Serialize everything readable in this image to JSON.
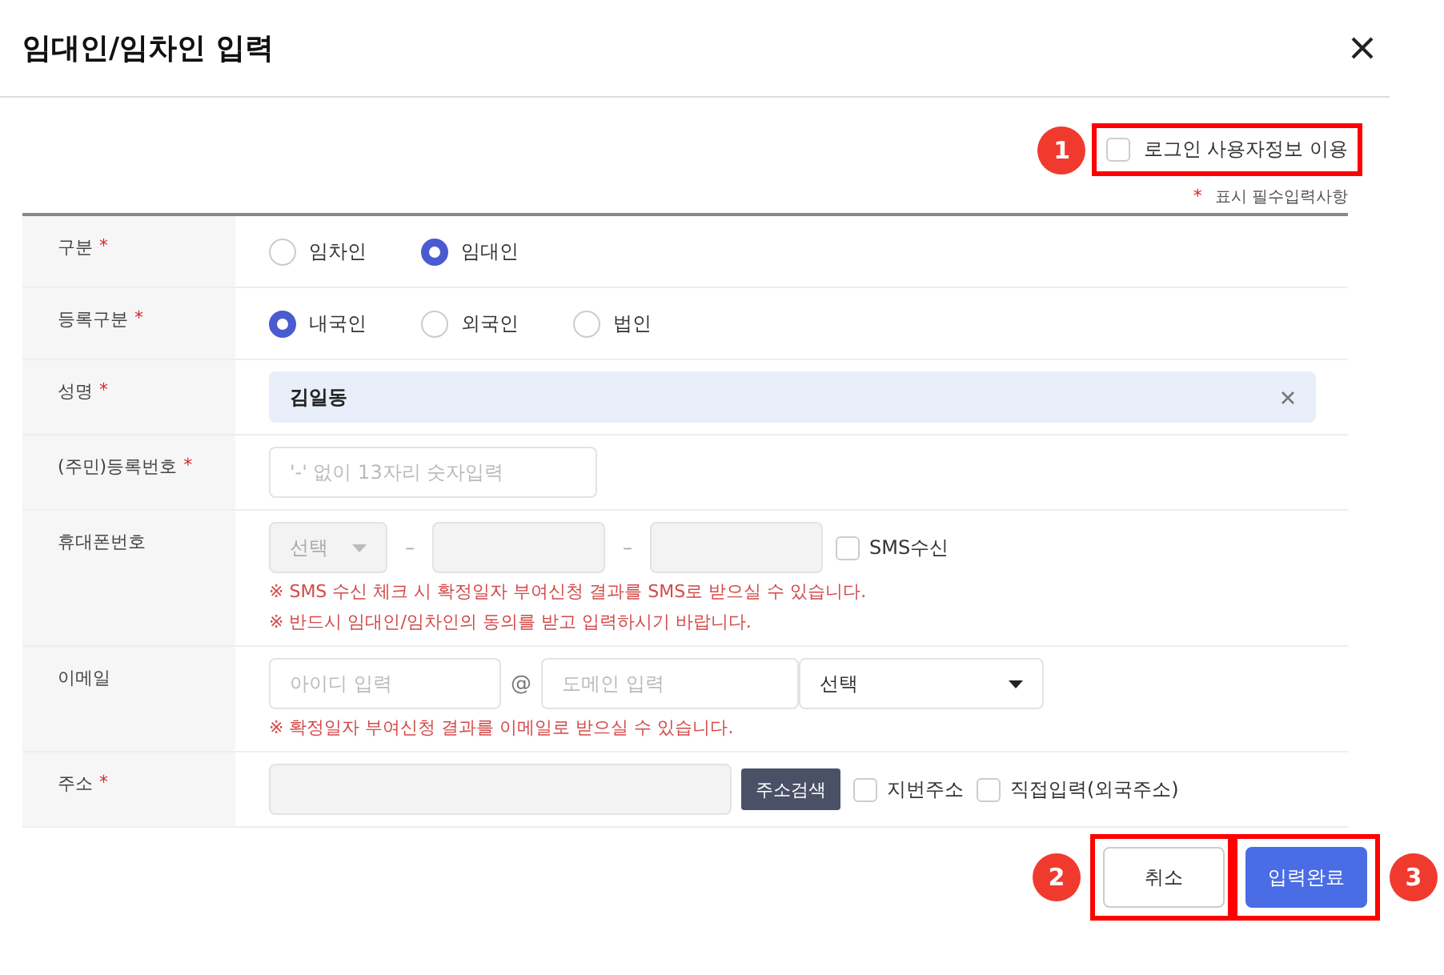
{
  "dialog": {
    "title": "임대인/임차인 입력"
  },
  "login_option": {
    "label": "로그인 사용자정보 이용",
    "checked": false,
    "callout": "1"
  },
  "required_note": {
    "mark": "*",
    "text": "표시 필수입력사항"
  },
  "rows": [
    {
      "kind": "radio",
      "label": "구분",
      "required_mark": "*",
      "options": [
        {
          "label": "임차인",
          "selected": false
        },
        {
          "label": "임대인",
          "selected": true
        }
      ]
    },
    {
      "kind": "radio",
      "label": "등록구분",
      "required_mark": "*",
      "options": [
        {
          "label": "내국인",
          "selected": true
        },
        {
          "label": "외국인",
          "selected": false
        },
        {
          "label": "법인",
          "selected": false
        }
      ]
    },
    {
      "kind": "text",
      "label": "성명",
      "required_mark": "*",
      "value": "김일동"
    },
    {
      "kind": "text",
      "label": "(주민)등록번호",
      "required_mark": "*",
      "placeholder": "'-' 없이 13자리 숫자입력"
    },
    {
      "kind": "phone",
      "label": "휴대폰번호",
      "select": "선택",
      "disabled": true,
      "separators": [
        "–",
        "–"
      ],
      "sms": {
        "label": "SMS수신",
        "checked": false
      },
      "notes": [
        "※ SMS 수신 체크 시 확정일자 부여신청 결과를 SMS로 받으실 수 있습니다.",
        "※ 반드시 임대인/임차인의 동의를 받고 입력하시기 바랍니다."
      ]
    },
    {
      "kind": "email",
      "label": "이메일",
      "id_placeholder": "아이디 입력",
      "at": "@",
      "domain_placeholder": "도메인 입력",
      "select": "선택",
      "notes": [
        "※ 확정일자 부여신청 결과를 이메일로 받으실 수 있습니다."
      ]
    },
    {
      "kind": "address",
      "label": "주소",
      "required_mark": "*",
      "button": "주소검색",
      "options": [
        {
          "label": "지번주소",
          "checked": false
        },
        {
          "label": "직접입력(외국주소)",
          "checked": false
        }
      ]
    }
  ],
  "buttons": [
    {
      "label": "취소",
      "kind": "secondary",
      "callout": "2"
    },
    {
      "label": "입력완료",
      "kind": "primary",
      "callout": "3"
    }
  ]
}
